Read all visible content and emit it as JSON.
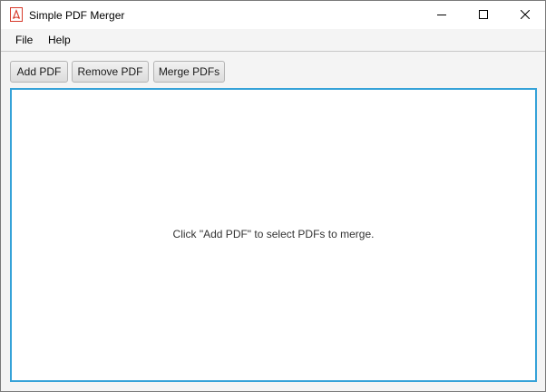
{
  "window": {
    "title": "Simple PDF Merger",
    "app_icon": "pdf-document-icon",
    "controls": {
      "minimize_icon": "minimize-icon",
      "maximize_icon": "maximize-icon",
      "close_icon": "close-icon"
    }
  },
  "menubar": {
    "items": [
      {
        "label": "File"
      },
      {
        "label": "Help"
      }
    ]
  },
  "toolbar": {
    "add_label": "Add PDF",
    "remove_label": "Remove PDF",
    "merge_label": "Merge PDFs"
  },
  "list": {
    "placeholder": "Click \"Add PDF\" to select PDFs to merge.",
    "focus_color": "#35a2d8"
  },
  "colors": {
    "app_icon_red": "#d63a2b"
  }
}
